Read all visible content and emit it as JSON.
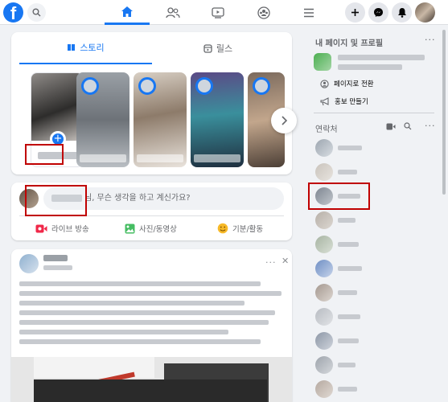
{
  "topbar": {
    "logo": "f",
    "nav": [
      "home-icon",
      "friends-icon",
      "watch-icon",
      "groups-icon",
      "menu-icon"
    ],
    "right_buttons": [
      "plus-icon",
      "messenger-icon",
      "bell-icon"
    ],
    "accent": "#1877f2"
  },
  "stories": {
    "tabs": [
      {
        "label": "스토리",
        "icon": "book-icon",
        "active": true
      },
      {
        "label": "릴스",
        "icon": "reels-icon",
        "active": false
      }
    ]
  },
  "composer": {
    "suffix": "님, 무슨 생각을 하고 계신가요?",
    "actions": [
      {
        "label": "라이브 방송",
        "icon": "live-video-icon",
        "color": "#f02849"
      },
      {
        "label": "사진/동영상",
        "icon": "photo-icon",
        "color": "#45bd62"
      },
      {
        "label": "기분/활동",
        "icon": "feeling-icon",
        "color": "#f7b928"
      }
    ]
  },
  "sidebar": {
    "pages_title": "내 페이지 및 프로필",
    "switch_label": "페이지로 전환",
    "promote_label": "홍보 만들기",
    "contacts_title": "연락처"
  }
}
